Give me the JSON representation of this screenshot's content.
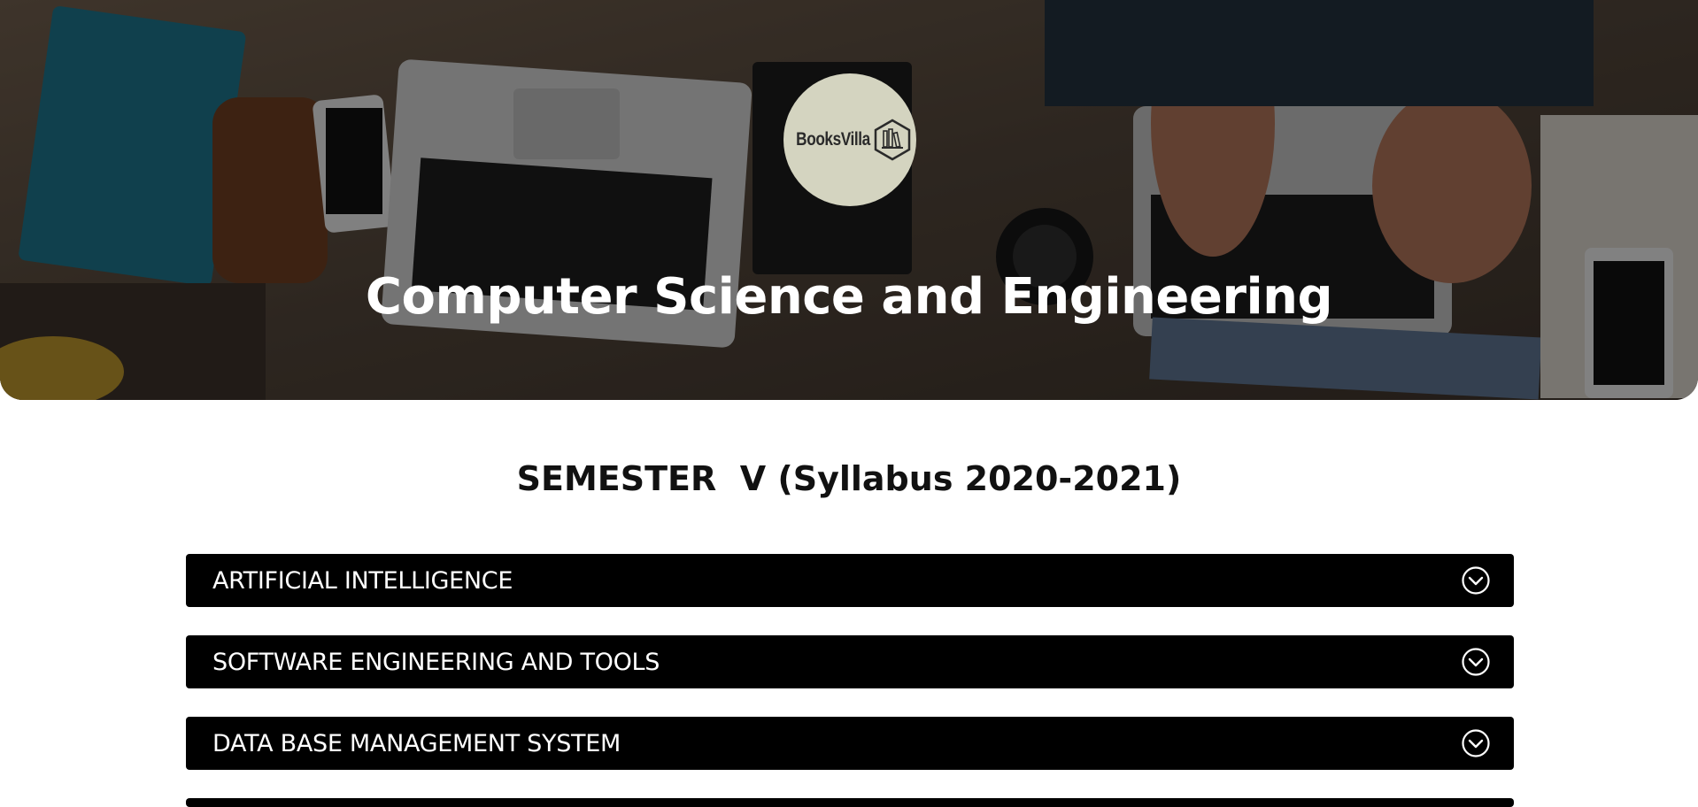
{
  "hero": {
    "logo_text": "BooksVilla",
    "title": "Computer Science and Engineering"
  },
  "semester_heading": "SEMESTER  V (Syllabus 2020-2021)",
  "subjects": [
    {
      "label": "ARTIFICIAL INTELLIGENCE",
      "icon": "chevron-down-circle-icon"
    },
    {
      "label": "SOFTWARE ENGINEERING AND TOOLS",
      "icon": "chevron-down-circle-icon"
    },
    {
      "label": "DATA BASE MANAGEMENT SYSTEM",
      "icon": "chevron-down-circle-icon"
    }
  ],
  "colors": {
    "accordion_bg": "#000000",
    "accordion_text": "#ffffff",
    "logo_bg": "#d4d4c0"
  }
}
